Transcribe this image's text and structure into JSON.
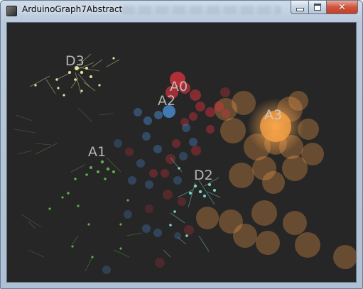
{
  "window": {
    "title": "ArduinoGraph7Abstract"
  },
  "controls": {
    "minimize": "minimize",
    "maximize": "maximize",
    "close": "close"
  },
  "labels": {
    "A0": "A0",
    "A1": "A1",
    "A2": "A2",
    "A3": "A3",
    "D2": "D2",
    "D3": "D3"
  },
  "colors": {
    "background": "#262626",
    "A0": "#e0343f",
    "A1": "#5fae4a",
    "A2": "#4a8fd6",
    "A3": "#f5a04a",
    "D2": "#7ed4c0",
    "D3": "#e3e39a"
  }
}
